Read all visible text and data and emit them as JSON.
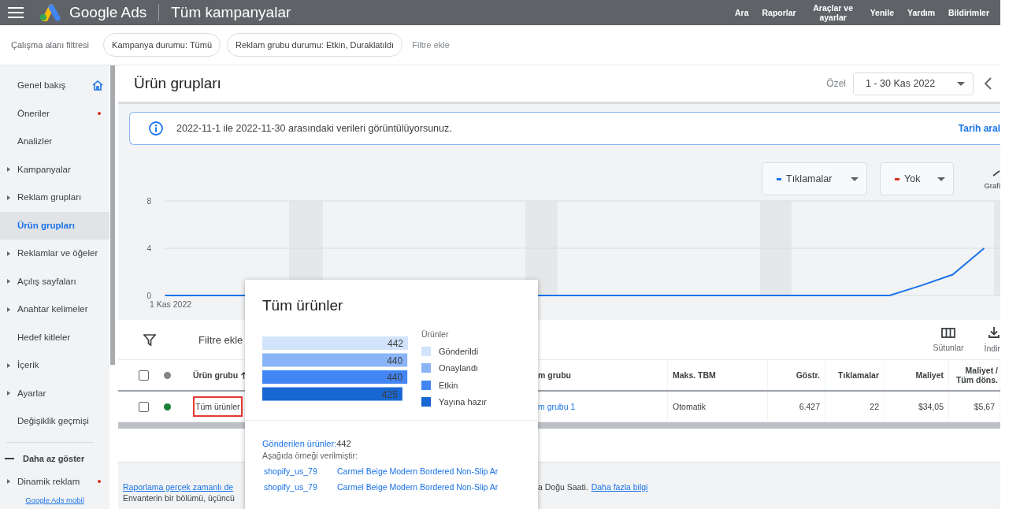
{
  "top_bar": {
    "product": "Google Ads",
    "page": "Tüm kampanyalar",
    "actions": [
      "Ara",
      "Raporlar",
      "Araçlar ve ayarlar",
      "Yenile",
      "Yardım",
      "Bildirimler"
    ]
  },
  "filter_bar": {
    "label": "Çalışma alanı filtresi",
    "chips": [
      "Kampanya durumu: Tümü",
      "Reklam grubu durumu: Etkin, Duraklatıldı"
    ],
    "add": "Filtre ekle"
  },
  "sidebar": {
    "items": [
      {
        "label": "Genel bakış",
        "expandable": false,
        "selected": false,
        "alert": false
      },
      {
        "label": "Öneriler",
        "expandable": false,
        "selected": false,
        "alert": true
      },
      {
        "label": "Analizler",
        "expandable": false,
        "selected": false,
        "alert": false
      },
      {
        "label": "Kampanyalar",
        "expandable": true,
        "selected": false,
        "alert": false
      },
      {
        "label": "Reklam grupları",
        "expandable": true,
        "selected": false,
        "alert": false
      },
      {
        "label": "Ürün grupları",
        "expandable": false,
        "selected": true,
        "alert": false
      },
      {
        "label": "Reklamlar ve öğeler",
        "expandable": true,
        "selected": false,
        "alert": false
      },
      {
        "label": "Açılış sayfaları",
        "expandable": true,
        "selected": false,
        "alert": false
      },
      {
        "label": "Anahtar kelimeler",
        "expandable": true,
        "selected": false,
        "alert": false
      },
      {
        "label": "Hedef kitleler",
        "expandable": false,
        "selected": false,
        "alert": false
      },
      {
        "label": "İçerik",
        "expandable": true,
        "selected": false,
        "alert": false
      },
      {
        "label": "Ayarlar",
        "expandable": true,
        "selected": false,
        "alert": false
      },
      {
        "label": "Değişiklik geçmişi",
        "expandable": false,
        "selected": false,
        "alert": false
      }
    ],
    "collapse": "Daha az göster",
    "extra_items": [
      {
        "label": "Dinamik reklam",
        "expandable": true,
        "selected": false,
        "alert": true
      }
    ],
    "footer_link": "Google Ads mobil"
  },
  "page": {
    "title": "Ürün grupları",
    "date_label": "Özel",
    "date_range": "1 - 30 Kas 2022"
  },
  "banner": {
    "text": "2022-11-1 ile 2022-11-30 arasındaki verileri görüntülüyorsunuz.",
    "link": "Tarih aral"
  },
  "metrics": [
    {
      "label": "Tıklamalar",
      "color": "#1a73e8"
    },
    {
      "label": "Yok",
      "color": "#d93025"
    }
  ],
  "chart_type_label": "Grafi",
  "chart": {
    "start_label": "1 Kas 2022",
    "chart_data": {
      "type": "line",
      "ylim": [
        0,
        8
      ],
      "yticks": [
        0,
        4,
        8
      ],
      "series": [
        {
          "color": "#1a73e8",
          "values": [
            0,
            0,
            0,
            null,
            null,
            null,
            null,
            null,
            null,
            null,
            null,
            null,
            0,
            0,
            0,
            0,
            0,
            0,
            0,
            0,
            0,
            0,
            0,
            0,
            0.84,
            1.77,
            4
          ]
        }
      ]
    }
  },
  "table": {
    "toolbar": {
      "filter": "Filtre ekle",
      "actions": [
        "Sütunlar",
        "İndir"
      ]
    },
    "header_checked": false,
    "header_status": {
      "color": "#80868b"
    },
    "columns": [
      {
        "label": "Ürün grubu",
        "kind": "text"
      },
      {
        "label": "m grubu",
        "kind": "text"
      },
      {
        "label": "Maks. TBM",
        "kind": "text"
      },
      {
        "label": "Göstr.",
        "kind": "number"
      },
      {
        "label": "Tıklamalar",
        "kind": "number"
      },
      {
        "label": "Maliyet",
        "kind": "number"
      },
      {
        "label": "Maliyet / Tüm döns.",
        "kind": "number"
      }
    ],
    "rows": [
      {
        "checked": false,
        "color": "#188038",
        "cells": [
          {
            "text": "Tüm ürünler",
            "kind": "text",
            "highlighted": true
          },
          {
            "text": "m grubu 1",
            "kind": "link",
            "highlighted": false
          },
          {
            "text": "Otomatik",
            "kind": "text",
            "highlighted": false
          },
          {
            "text": "6.427",
            "kind": "number",
            "highlighted": false
          },
          {
            "text": "22",
            "kind": "number",
            "highlighted": false
          },
          {
            "text": "$34,05",
            "kind": "number",
            "highlighted": false
          },
          {
            "text": "$5,67",
            "kind": "number",
            "highlighted": false
          }
        ]
      }
    ]
  },
  "notes": {
    "link": "Raporlama gerçek zamanlı de",
    "text": "a Doğu Saati.",
    "more": "Daha fazla bilgi",
    "line2": "Envanterin bir bölümü, üçüncü"
  },
  "popover": {
    "title": "Tüm ürünler",
    "chart_data": {
      "type": "bar",
      "orientation": "horizontal",
      "categories": [
        "Gönderildi",
        "Onaylandı",
        "Etkin",
        "Yayına hazır"
      ],
      "series": [
        {
          "name": "Ürünler",
          "values": [
            442,
            440,
            440,
            425
          ]
        }
      ],
      "data_labels": true
    },
    "legend": [
      {
        "color": "#d2e3fc"
      },
      {
        "color": "#8ab4f8"
      },
      {
        "color": "#4285f4"
      },
      {
        "color": "#1967d2"
      }
    ],
    "submitted_label": "Gönderilen ürünler:",
    "submitted_count": "442",
    "sample_note": "Aşağıda örneği verilmiştir:",
    "samples": [
      {
        "id": "shopify_us_79",
        "title": "Carmel Beige Modern Bordered Non-Slip Ar"
      },
      {
        "id": "shopify_us_79",
        "title": "Carmel Beige Modern Bordered Non-Slip Ar"
      }
    ]
  }
}
